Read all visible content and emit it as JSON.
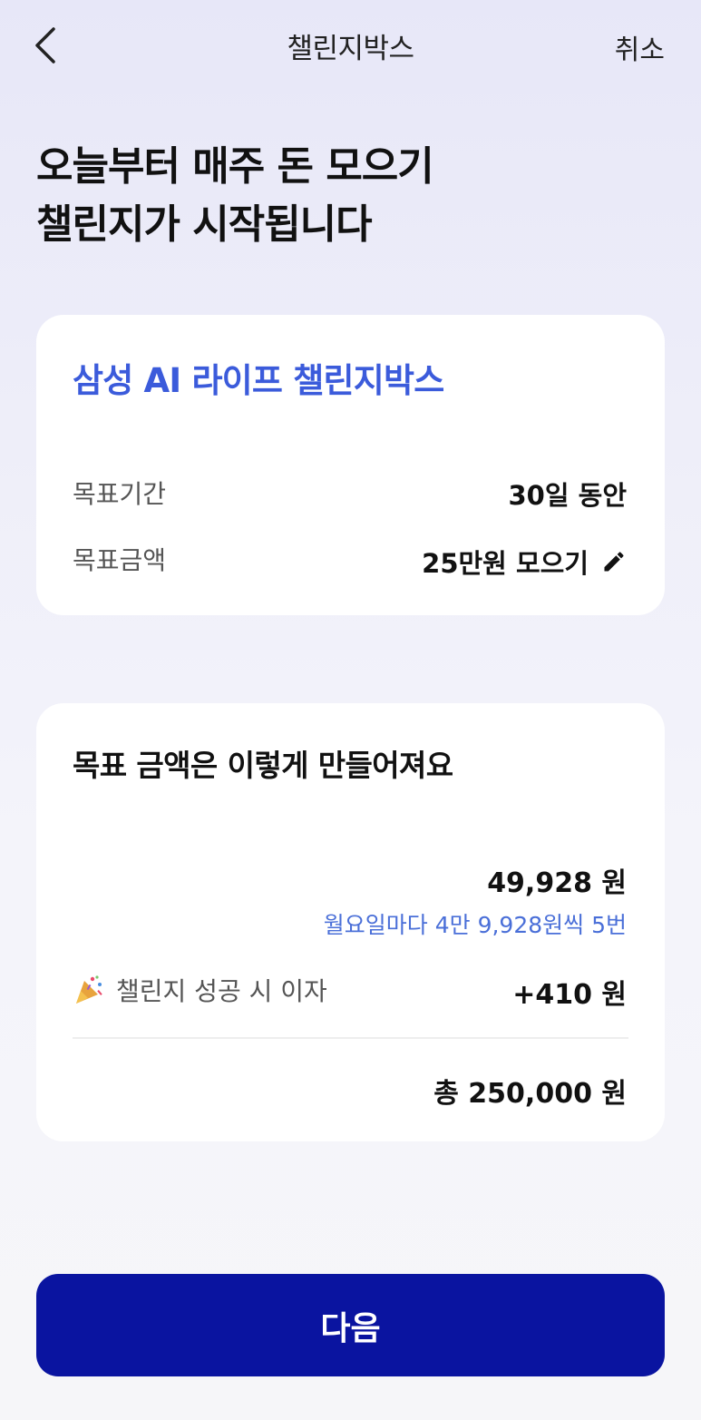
{
  "header": {
    "title": "챌린지박스",
    "cancel_label": "취소",
    "back_icon": "chevron-left-icon"
  },
  "headline": {
    "line1": "오늘부터 매주 돈 모으기",
    "line2": "챌린지가 시작됩니다"
  },
  "summary_card": {
    "product_name": "삼성 AI 라이프 챌린지박스",
    "period_label": "목표기간",
    "period_value": "30일 동안",
    "amount_label": "목표금액",
    "amount_value": "25만원 모으기",
    "edit_icon": "pencil-icon"
  },
  "breakdown_card": {
    "title": "목표 금액은 이렇게 만들어져요",
    "installment_amount": "49,928 원",
    "installment_desc": "월요일마다 4만 9,928원씩 5번",
    "interest_label": "챌린지 성공 시 이자",
    "interest_icon": "party-popper-icon",
    "interest_value": "+410 원",
    "total": "총 250,000 원"
  },
  "footer": {
    "next_label": "다음"
  },
  "colors": {
    "accent_blue": "#3b5bdb",
    "button_navy": "#0a14a0",
    "sub_text_blue": "#4a6fd8"
  }
}
